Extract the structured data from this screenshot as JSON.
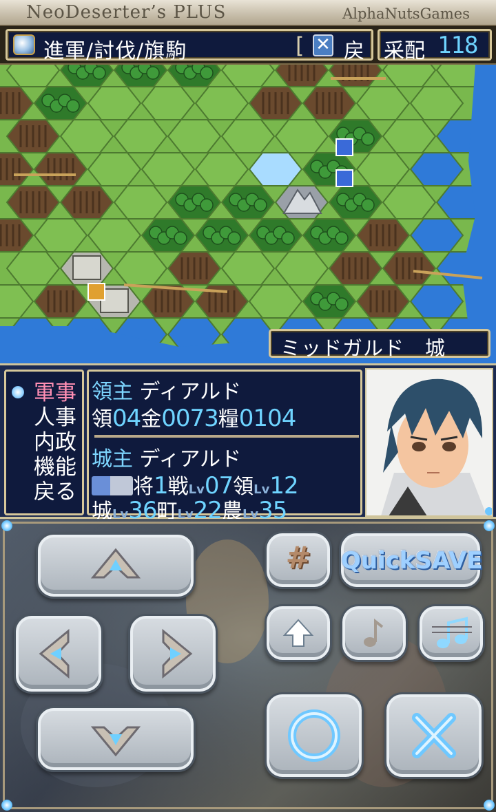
{
  "window": {
    "app_title": "NeoDeserter’s PLUS",
    "developer": "AlphaNutsGames"
  },
  "command_bar": {
    "icon": "crystal-icon",
    "mode_text": "進軍/討伐/旗駒",
    "cancel_icon": "x-box-icon",
    "cancel_symbol": "✕",
    "back_label": "戻",
    "command_points_label": "采配",
    "command_points_value": "118"
  },
  "map": {
    "location_label": "ミッドガルド　城",
    "colors": {
      "grass": "#7fbf52",
      "forest": "#2f7a2a",
      "field": "#6a4a2e",
      "water": "#2f7ad8",
      "lake": "#a9dcff",
      "road": "#c9a25a"
    }
  },
  "info": {
    "menu": [
      "軍事",
      "人事",
      "内政",
      "機能",
      "戻る"
    ],
    "menu_selected": "軍事",
    "lord": {
      "label": "領主",
      "name": "ディアルド",
      "territory_label": "領",
      "territory_value": "04",
      "gold_label": "金",
      "gold_value": "0073",
      "food_label": "糧",
      "food_value": "0104"
    },
    "castle": {
      "label": "城主",
      "name": "ディアルド",
      "unit_icon": "army-unit-icon",
      "general_label": "将",
      "general_value": "1",
      "battle_label": "戦",
      "battle_lv": "07",
      "domain_label": "領",
      "domain_lv": "12",
      "castle_label": "城",
      "castle_lv": "36",
      "town_label": "町",
      "town_lv": "22",
      "farm_label": "農",
      "farm_lv": "35",
      "lv_label": "Lv"
    },
    "portrait": "lord-portrait"
  },
  "controller": {
    "up_icon": "arrow-up-icon",
    "down_icon": "arrow-down-icon",
    "left_icon": "arrow-left-icon",
    "right_icon": "arrow-right-icon",
    "hash_label": "#",
    "quicksave_label": "QuickSAVE",
    "scroll_up_icon": "scroll-up-icon",
    "sound_icon": "note-icon",
    "bgm_icon": "music-note-icon",
    "ok_icon": "circle-icon",
    "cancel_icon": "cross-icon"
  }
}
